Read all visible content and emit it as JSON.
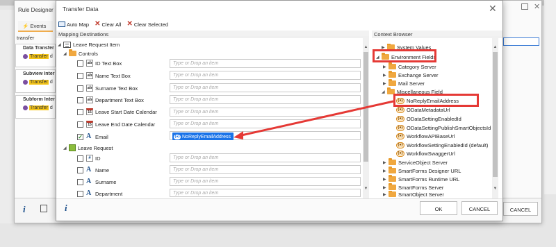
{
  "outer": {
    "title": "Rule Designer",
    "tab_events": "Events",
    "search_value": "transfer",
    "groups": [
      {
        "title": "Data Transfer",
        "item": "Transfer",
        "suffix": "d"
      },
      {
        "title": "Subview Inter",
        "item": "Transfer",
        "suffix": "d"
      },
      {
        "title": "Subform Inter",
        "item": "Transfer",
        "suffix": "d"
      }
    ],
    "cancel_label": "CANCEL",
    "info_glyph": "i"
  },
  "dialog": {
    "title": "Transfer Data",
    "close_glyph": "✕",
    "toolbar": {
      "auto_map": "Auto Map",
      "clear_all": "Clear All",
      "clear_selected": "Clear Selected"
    },
    "mapping_header": "Mapping Destinations",
    "context_header": "Context Browser",
    "drop_placeholder": "Type or Drop an item",
    "mapping_tree": {
      "root": "Leave Request Item",
      "controls_folder": "Controls",
      "controls": [
        {
          "label": "ID Text Box",
          "icon": "textbox-icon",
          "checked": false
        },
        {
          "label": "Name Text Box",
          "icon": "textbox-icon",
          "checked": false
        },
        {
          "label": "Surname Text Box",
          "icon": "textbox-icon",
          "checked": false
        },
        {
          "label": "Department Text Box",
          "icon": "textbox-icon",
          "checked": false
        },
        {
          "label": "Leave Start Date Calendar",
          "icon": "calendar-icon",
          "checked": false
        },
        {
          "label": "Leave End Date Calendar",
          "icon": "calendar-icon",
          "checked": false
        },
        {
          "label": "Email",
          "icon": "text-field-icon",
          "checked": true,
          "mapped_value": "NoReplyEmailAddress"
        }
      ],
      "smartobject": "Leave Request",
      "properties": [
        {
          "label": "ID",
          "icon": "id-icon",
          "checked": false
        },
        {
          "label": "Name",
          "icon": "text-field-icon",
          "checked": false
        },
        {
          "label": "Surname",
          "icon": "text-field-icon",
          "checked": false
        },
        {
          "label": "Department",
          "icon": "text-field-icon",
          "checked": false
        }
      ]
    },
    "context_tree": {
      "system_values": "System Values",
      "environment_fields": "Environment Fields",
      "env_children": [
        "Category Server",
        "Exchange Server",
        "Mail Server"
      ],
      "misc_field": "Miscellaneous Field",
      "misc_children": [
        "NoReplyEmailAddress",
        "ODataMetadataUrl",
        "ODataSettingEnabledId",
        "ODataSettingPublishSmartObjectsId",
        "WorkflowAPIBaseUrl",
        "WorkflowSettingEnabledId (default)",
        "WorkflowSwaggerUrl"
      ],
      "more_folders": [
        "ServiceObject Server",
        "SmartForms Designer URL",
        "SmartForms Runtime URL",
        "SmartForms Server",
        "SmartObject Server"
      ]
    },
    "footer": {
      "ok": "OK",
      "cancel": "CANCEL",
      "info_glyph": "i"
    }
  },
  "colors": {
    "highlight": "#e53935",
    "chip": "#1a73e8",
    "folder": "#f0a840"
  }
}
